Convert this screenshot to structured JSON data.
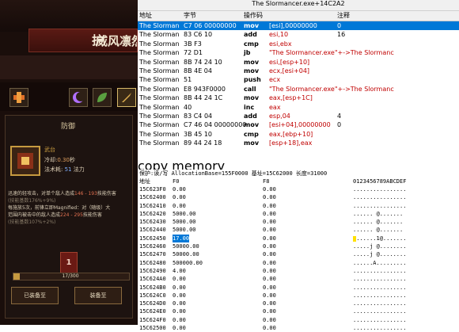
{
  "game": {
    "title": "威风凛然",
    "title_char": "护",
    "skill_panel_title": "防御",
    "skill_name": "武台",
    "cooldown_label": "冷却:",
    "cooldown_value": "0.30",
    "cooldown_unit": "秒",
    "cost_label": "法术耗:",
    "cost_value": "51",
    "cost_unit": "法力",
    "desc_line1": "迅速的轻攻击，对单个敌人造成",
    "desc_dmg1": "146 - 193",
    "desc_line1b": "技能伤害",
    "desc_dim1": "(技能基数176%+9%)",
    "desc_line2": "每施放5次，前锋立即Magnified：对（随级）大",
    "desc_line3": "范围内被击中的敌人造成",
    "desc_dmg2": "224 - 295",
    "desc_line3b": "技能伤害",
    "desc_dim2": "(技能基数107%+2%)",
    "level_badge": "1",
    "progress_text": "17/300",
    "progress_fraction": 0.0567,
    "button_left": "已装备至",
    "button_right": "装备至",
    "tabs": [
      "fire-rune-icon",
      "crescent-icon",
      "leaf-icon",
      "sword-icon"
    ],
    "accent_color": "#c69a40"
  },
  "disassembler": {
    "window_title": "The Slormancer.exe+14C2A2",
    "headers": {
      "address": "地址",
      "bytes": "字节",
      "opcode": "操作码",
      "comment": "注释"
    },
    "rows": [
      {
        "address": "The Slorman",
        "bytes": "C7 06 00000000",
        "mnemonic": "mov",
        "operand": "[esi],00000000",
        "comment": "0",
        "selected": true
      },
      {
        "address": "The Slorman",
        "bytes": "83 C6 10",
        "mnemonic": "add",
        "operand": "esi,10",
        "comment": "16",
        "selected": false
      },
      {
        "address": "The Slorman",
        "bytes": "3B F3",
        "mnemonic": "cmp",
        "operand": "esi,ebx",
        "comment": "",
        "selected": false
      },
      {
        "address": "The Slorman",
        "bytes": "72 D1",
        "mnemonic": "jb",
        "operand": "\"The Slormancer.exe\"+->The Slormanc",
        "comment": "",
        "selected": false
      },
      {
        "address": "The Slorman",
        "bytes": "8B 74 24 10",
        "mnemonic": "mov",
        "operand": "esi,[esp+10]",
        "comment": "",
        "selected": false
      },
      {
        "address": "The Slorman",
        "bytes": "8B 4E 04",
        "mnemonic": "mov",
        "operand": "ecx,[esi+04]",
        "comment": "",
        "selected": false
      },
      {
        "address": "The Slorman",
        "bytes": "51",
        "mnemonic": "push",
        "operand": "ecx",
        "comment": "",
        "selected": false
      },
      {
        "address": "The Slorman",
        "bytes": "E8 943F0000",
        "mnemonic": "call",
        "operand": "\"The Slormancer.exe\"+->The Slormanc",
        "comment": "",
        "selected": false
      },
      {
        "address": "The Slorman",
        "bytes": "8B 44 24 1C",
        "mnemonic": "mov",
        "operand": "eax,[esp+1C]",
        "comment": "",
        "selected": false
      },
      {
        "address": "The Slorman",
        "bytes": "40",
        "mnemonic": "inc",
        "operand": "eax",
        "comment": "",
        "selected": false
      },
      {
        "address": "The Slorman",
        "bytes": "83 C4 04",
        "mnemonic": "add",
        "operand": "esp,04",
        "comment": "4",
        "selected": false
      },
      {
        "address": "The Slorman",
        "bytes": "C7 46 04 00000000",
        "mnemonic": "mov",
        "operand": "[esi+04],00000000",
        "comment": "0",
        "selected": false
      },
      {
        "address": "The Slorman",
        "bytes": "3B 45 10",
        "mnemonic": "cmp",
        "operand": "eax,[ebp+10]",
        "comment": "",
        "selected": false
      },
      {
        "address": "The Slorman",
        "bytes": "89 44 24 18",
        "mnemonic": "mov",
        "operand": "[esp+18],eax",
        "comment": "",
        "selected": false
      }
    ],
    "copy_label": "copy memory"
  },
  "memory": {
    "info_line": "保护:读/写  AllocationBase=155F0000  基址=15C62000  长度=31000",
    "headers": {
      "address": "地址",
      "f0": "F0",
      "f8": "F8",
      "ascii": "0123456789ABCDEF"
    },
    "rows": [
      {
        "address": "15C623F0",
        "f0": "0.00",
        "f8": "0.00",
        "ascii": "................",
        "hl": false
      },
      {
        "address": "15C62400",
        "f0": "0.00",
        "f8": "0.00",
        "ascii": "................",
        "hl": false
      },
      {
        "address": "15C62410",
        "f0": "0.00",
        "f8": "0.00",
        "ascii": "................",
        "hl": false
      },
      {
        "address": "15C62420",
        "f0": "5000.00",
        "f8": "0.00",
        "ascii": "......  @.......",
        "hl": false
      },
      {
        "address": "15C62430",
        "f0": "5000.00",
        "f8": "0.00",
        "ascii": "......  @.......",
        "hl": false
      },
      {
        "address": "15C62440",
        "f0": "5000.00",
        "f8": "0.00",
        "ascii": "......  @.......",
        "hl": false
      },
      {
        "address": "15C62450",
        "f0": "17.00",
        "f8": "0.00",
        "ascii": ".......1@.......",
        "hl": true
      },
      {
        "address": "15C62460",
        "f0": "50000.00",
        "f8": "0.00",
        "ascii": ".....j @........",
        "hl": false
      },
      {
        "address": "15C62470",
        "f0": "50000.00",
        "f8": "0.00",
        "ascii": ".....j @........",
        "hl": false
      },
      {
        "address": "15C62480",
        "f0": "500000.00",
        "f8": "0.00",
        "ascii": "......A.........",
        "hl": false
      },
      {
        "address": "15C62490",
        "f0": "4.00",
        "f8": "0.00",
        "ascii": "................",
        "hl": false
      },
      {
        "address": "15C624A0",
        "f0": "0.00",
        "f8": "0.00",
        "ascii": "................",
        "hl": false
      },
      {
        "address": "15C624B0",
        "f0": "0.00",
        "f8": "0.00",
        "ascii": "................",
        "hl": false
      },
      {
        "address": "15C624C0",
        "f0": "0.00",
        "f8": "0.00",
        "ascii": "................",
        "hl": false
      },
      {
        "address": "15C624D0",
        "f0": "0.00",
        "f8": "0.00",
        "ascii": "................",
        "hl": false
      },
      {
        "address": "15C624E0",
        "f0": "0.00",
        "f8": "0.00",
        "ascii": "................",
        "hl": false
      },
      {
        "address": "15C624F0",
        "f0": "0.00",
        "f8": "0.00",
        "ascii": "................",
        "hl": false
      },
      {
        "address": "15C62500",
        "f0": "0.00",
        "f8": "0.00",
        "ascii": "................",
        "hl": false
      }
    ]
  }
}
